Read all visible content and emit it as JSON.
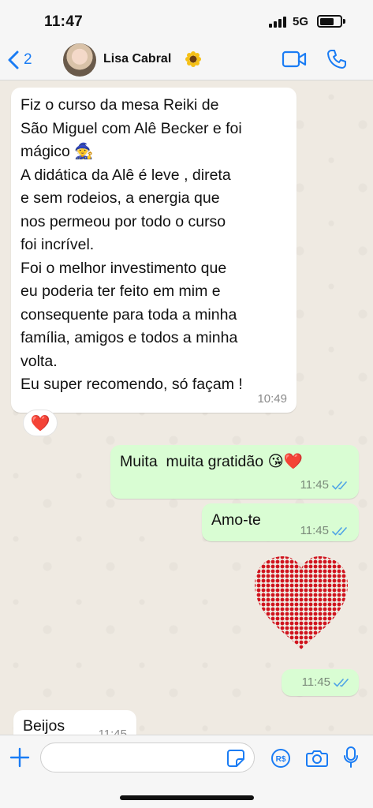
{
  "status_bar": {
    "time": "11:47",
    "network": "5G",
    "battery_level": 0.7
  },
  "header": {
    "back_count": "2",
    "contact_name": "Lisa Cabral",
    "contact_emoji_icon": "sunflower-icon",
    "accent_color": "#1a7cf4"
  },
  "messages": [
    {
      "direction": "in",
      "text": "Fiz o curso da mesa Reiki de\nSão Miguel com Alê Becker e foi\nmágico 🧙\nA didática da Alê é leve , direta\ne sem rodeios, a energia que\nnos permeou por todo o curso\nfoi incrível.\nFoi o melhor investimento que\neu poderia ter feito em mim e\nconsequente para toda a minha\nfamília, amigos e todos a minha\nvolta.\nEu super recomendo, só façam !",
      "time": "10:49",
      "reaction": "❤️"
    },
    {
      "direction": "out",
      "text": "Muita  muita gratidão 😘❤️",
      "time": "11:45",
      "status": "read"
    },
    {
      "direction": "out",
      "text": "Amo-te",
      "time": "11:45",
      "status": "read"
    },
    {
      "direction": "out",
      "type": "sticker",
      "sticker": "heart-sticker-icon",
      "time": "11:45",
      "status": "read"
    },
    {
      "direction": "in",
      "text": "Beijos",
      "time": "11:45"
    }
  ],
  "input": {
    "placeholder": "",
    "value": ""
  },
  "colors": {
    "incoming_bubble": "#ffffff",
    "outgoing_bubble": "#d9fdd3",
    "chat_bg": "#efeae2",
    "read_tick": "#4fa3e6",
    "reaction_heart": "#e0202a"
  }
}
